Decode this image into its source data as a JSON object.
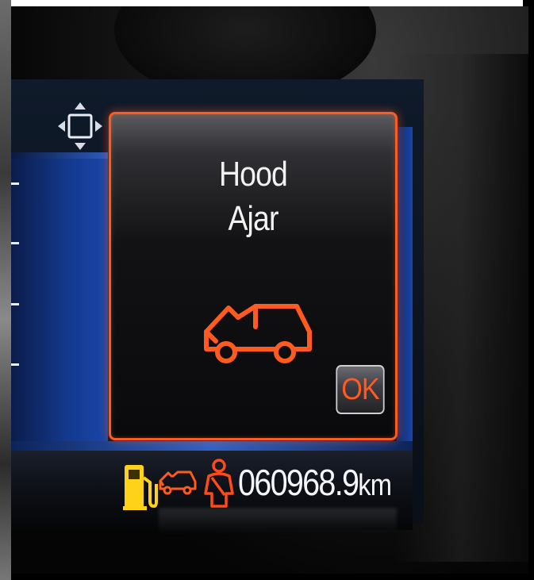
{
  "warning": {
    "line1": "Hood",
    "line2": "Ajar",
    "ok_label": "OK"
  },
  "status_bar": {
    "odometer_value": "060968.9",
    "odometer_unit": "km"
  },
  "icons": {
    "navigation": "four-way-navigation-icon",
    "hood": "hood-open-icon",
    "fuel": "fuel-pump-icon",
    "seatbelt": "seatbelt-warning-icon"
  },
  "colors": {
    "warning_amber": "#ff5a1f",
    "fuel_yellow": "#ffd21a",
    "gauge_blue": "#1a46a8",
    "text_white": "#f2f2f2"
  }
}
